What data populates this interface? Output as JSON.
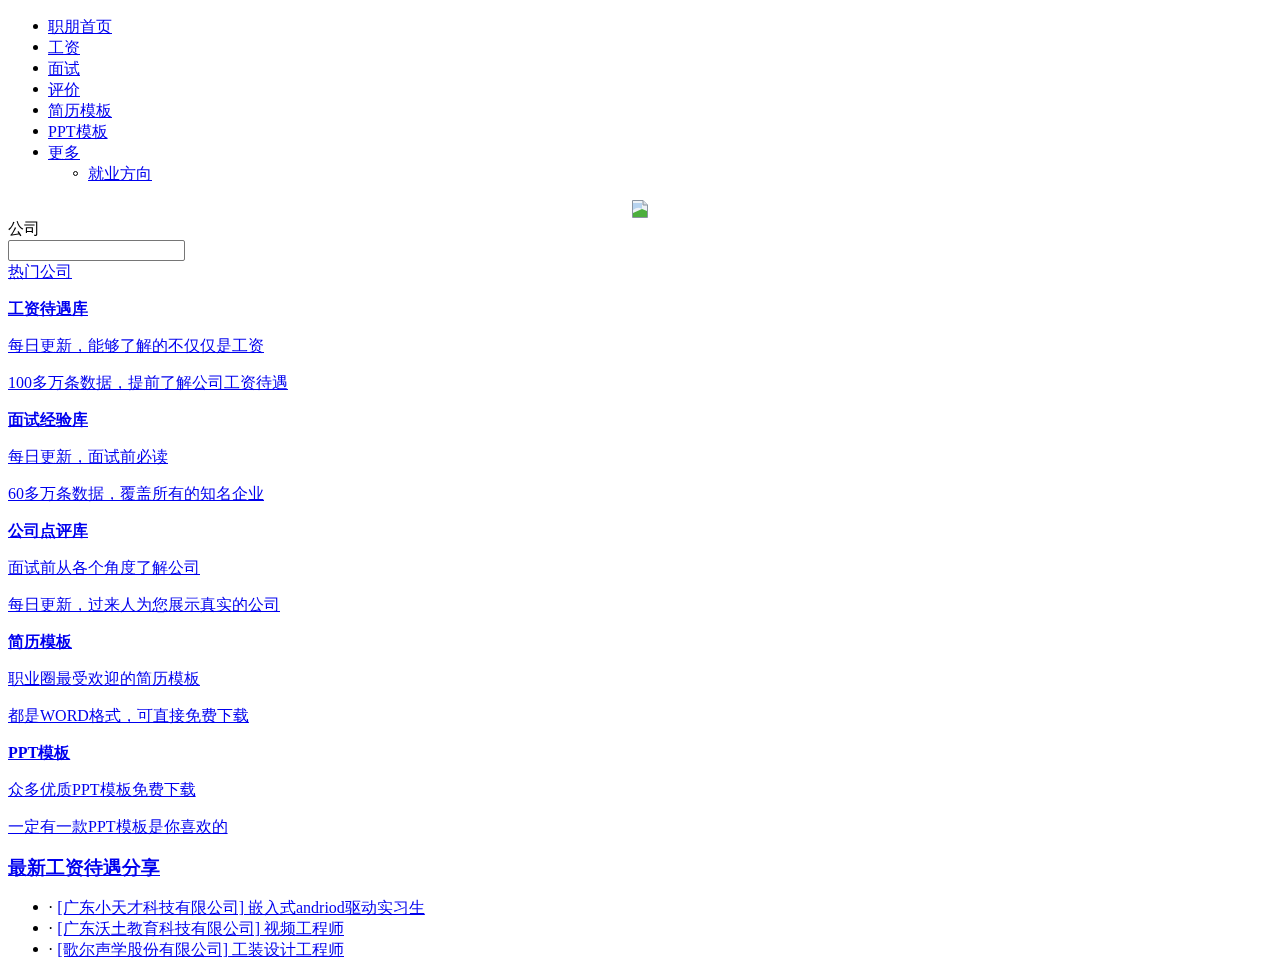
{
  "nav": [
    {
      "label": "职朋首页"
    },
    {
      "label": "工资"
    },
    {
      "label": "面试"
    },
    {
      "label": "评价"
    },
    {
      "label": "简历模板"
    },
    {
      "label": "PPT模板"
    },
    {
      "label": "更多",
      "children": [
        {
          "label": "就业方向"
        }
      ]
    }
  ],
  "search": {
    "label": "公司",
    "hot_link": "热门公司"
  },
  "features": [
    {
      "title": "工资待遇库",
      "lines": [
        "每日更新，能够了解的不仅仅是工资",
        "100多万条数据，提前了解公司工资待遇"
      ]
    },
    {
      "title": "面试经验库",
      "lines": [
        "每日更新，面试前必读",
        "60多万条数据，覆盖所有的知名企业"
      ]
    },
    {
      "title": "公司点评库",
      "lines": [
        "面试前从各个角度了解公司",
        "每日更新，过来人为您展示真实的公司"
      ]
    },
    {
      "title": "简历模板",
      "lines": [
        "职业圈最受欢迎的简历模板",
        "都是WORD格式，可直接免费下载"
      ]
    },
    {
      "title": "PPT模板",
      "lines": [
        "众多优质PPT模板免费下载",
        "一定有一款PPT模板是你喜欢的"
      ]
    }
  ],
  "latest": {
    "title": "最新工资待遇分享",
    "items": [
      {
        "prefix": "·",
        "link": "[广东小天才科技有限公司] 嵌入式andriod驱动实习生"
      },
      {
        "prefix": "·",
        "link": "[广东沃土教育科技有限公司] 视频工程师"
      },
      {
        "prefix": "·",
        "link": "[歌尔声学股份有限公司] 工装设计工程师"
      }
    ]
  }
}
